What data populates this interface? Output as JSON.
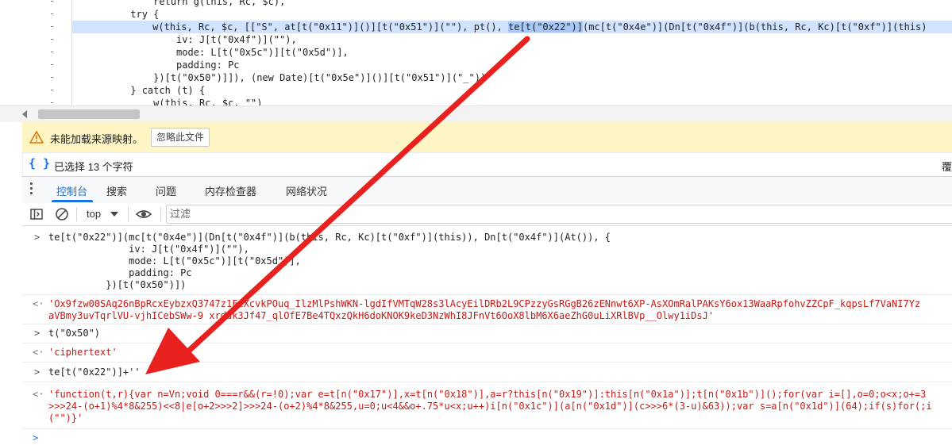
{
  "source": {
    "lines": [
      {
        "n": "-",
        "text": "              return g(this, Rc, $c),"
      },
      {
        "n": "-",
        "text": "          try {"
      },
      {
        "n": "-",
        "pre": "              w(this, Rc, $c, [[\"S\", at[t(\"0x11\")]()][t(\"0x51\")](\"\"), pt(), ",
        "sel": "te[t(\"0x22\")]",
        "post": "(mc[t(\"0x4e\")](Dn[t(\"0x4f\")](b(this, Rc, Kc)[t(\"0xf\")](this)"
      },
      {
        "n": "-",
        "text": "                  iv: J[t(\"0x4f\")](\"\"),"
      },
      {
        "n": "-",
        "text": "                  mode: L[t(\"0x5c\")][t(\"0x5d\")],"
      },
      {
        "n": "-",
        "text": "                  padding: Pc"
      },
      {
        "n": "-",
        "text": "              })[t(\"0x50\")]]), (new Date)[t(\"0x5e\")]()][t(\"0x51\")](\"_\"))"
      },
      {
        "n": "-",
        "text": "          } catch (t) {"
      },
      {
        "n": "-",
        "text": "              w(this, Rc, $c, \"\")"
      }
    ]
  },
  "warning": {
    "text": "未能加载来源映射。",
    "ignore_button": "忽略此文件"
  },
  "status": {
    "selection": "已选择 13 个字符",
    "right": "覆"
  },
  "drawer": {
    "tabs": [
      "控制台",
      "搜索",
      "问题",
      "内存检查器",
      "网络状况"
    ]
  },
  "toolbar": {
    "context": "top",
    "filter_placeholder": "过滤"
  },
  "console": {
    "entry1_lines": [
      "te[t(\"0x22\")](mc[t(\"0x4e\")](Dn[t(\"0x4f\")](b(this, Rc, Kc)[t(\"0xf\")](this)), Dn[t(\"0x4f\")](At()), {",
      "              iv: J[t(\"0x4f\")](\"\"),",
      "              mode: L[t(\"0x5c\")][t(\"0x5d\")],",
      "              padding: Pc",
      "          })[t(\"0x50\")])"
    ],
    "result1_lines": [
      "'Ox9fzw00SAq26nBpRcxEybzxQ3747z1FzXcvkPOuq_IlzMlPshWKN-lgdIfVMTqW28s3lAcyEilDRb2L9CPzzyGsRGgB26zENnwt6XP-AsXOmRalPAKsY6ox13WaaRpfohvZZCpF_kqpsLf7VaNI7Yz",
      "aVBmy3uvTqrlVU-vjhICebSWw-9 xrddk3Jf47_qlOfE7Be4TQxzQkH6doKNOK9keD3NzWhI8JFnVt6OoX8lbM6X6aeZhG0uLiXRlBVp__Olwy1iDsJ'"
    ],
    "entry2": "t(\"0x50\")",
    "result2": "'ciphertext'",
    "entry3": "te[t(\"0x22\")]+''",
    "result3_lines": [
      "'function(t,r){var n=Vn;void 0===r&&(r=!0);var e=t[n(\"0x17\")],x=t[n(\"0x18\")],a=r?this[n(\"0x19\")]:this[n(\"0x1a\")];t[n(\"0x1b\")]();for(var i=[],o=0;o<x;o+=3",
      ">>>24-(o+1)%4*8&255)<<8|e[o+2>>>2]>>>24-(o+2)%4*8&255,u=0;u<4&&o+.75*u<x;u++)i[n(\"0x1c\")](a[n(\"0x1d\")](c>>>6*(3-u)&63));var s=a[n(\"0x1d\")](64);if(s)for(;i",
      "(\"\")}'"
    ]
  },
  "colors": {
    "accent": "#1a73e8",
    "warning_bg": "#fff4c4",
    "selection": "#d1e3ff",
    "arrow": "#e8211e",
    "string_result": "#c41a16"
  }
}
